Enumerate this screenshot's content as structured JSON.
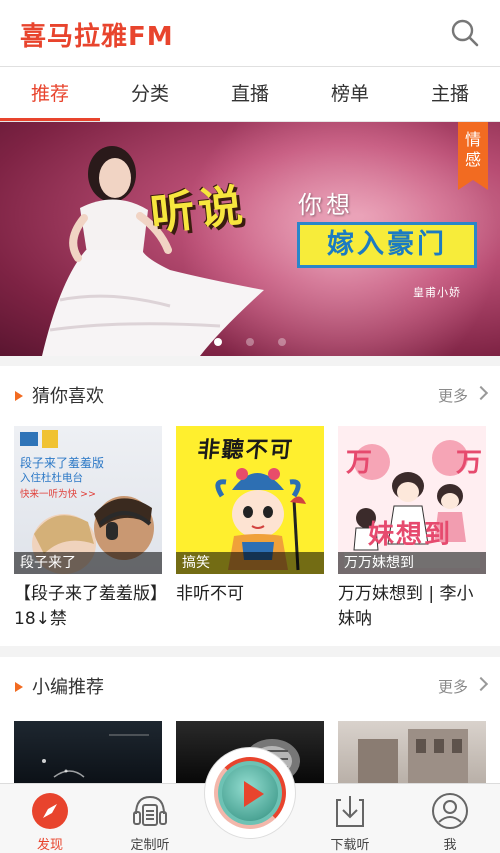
{
  "app": {
    "logo": "喜马拉雅FM"
  },
  "tabs": [
    {
      "label": "推荐",
      "active": true
    },
    {
      "label": "分类",
      "active": false
    },
    {
      "label": "直播",
      "active": false
    },
    {
      "label": "榜单",
      "active": false
    },
    {
      "label": "主播",
      "active": false
    }
  ],
  "banner": {
    "headline": "听说",
    "line1": "你想",
    "line2": "嫁入豪门",
    "host": "皇甫小娇",
    "category_tag": "情感",
    "slide_index": 0,
    "slide_count": 3
  },
  "section1": {
    "title": "猜你喜欢",
    "more": "更多",
    "cards": [
      {
        "thumb_label": "段子来了",
        "title": "【段子来了羞羞版】18↓禁",
        "thumb_text": [
          "段子来了羞羞版",
          "入住杜杜电台",
          "快来一听为快 >>"
        ]
      },
      {
        "thumb_label": "搞笑",
        "title": "非听不可",
        "thumb_text": [
          "非聽不可"
        ]
      },
      {
        "thumb_label": "万万妹想到",
        "title": "万万妹想到 | 李小妹呐",
        "thumb_text": [
          "万",
          "万",
          "妹想到"
        ]
      }
    ]
  },
  "section2": {
    "title": "小编推荐",
    "more": "更多"
  },
  "bottom_nav": [
    {
      "label": "发现",
      "icon": "compass-icon",
      "active": true
    },
    {
      "label": "定制听",
      "icon": "headphones-list-icon",
      "active": false
    },
    {
      "label": "下载听",
      "icon": "download-icon",
      "active": false
    },
    {
      "label": "我",
      "icon": "profile-icon",
      "active": false
    }
  ],
  "colors": {
    "accent": "#e8442d",
    "orange": "#f26b21",
    "teal": "#6dc2b4"
  }
}
